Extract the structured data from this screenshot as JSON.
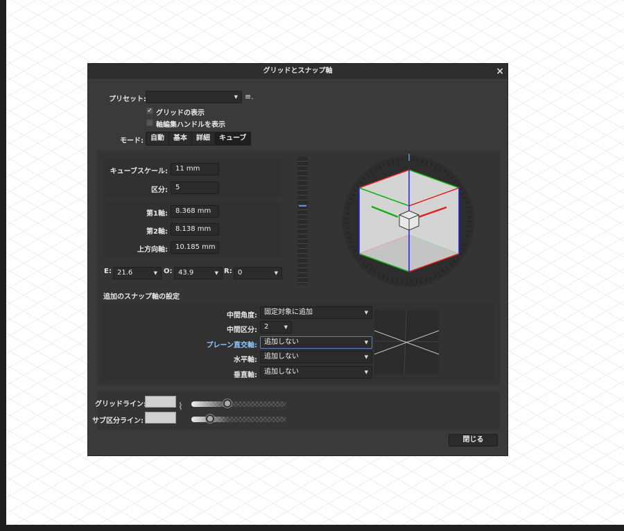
{
  "dialog": {
    "title": "グリッドとスナップ軸",
    "close_icon": "×",
    "close_button": "閉じる"
  },
  "preset": {
    "label": "プリセット:",
    "value": "",
    "menu_icon": "≡."
  },
  "checkboxes": [
    {
      "label": "グリッドの表示",
      "checked": true
    },
    {
      "label": "軸編集ハンドルを表示",
      "checked": false
    }
  ],
  "mode": {
    "label": "モード:",
    "options": [
      "自動",
      "基本",
      "詳細",
      "キューブ"
    ],
    "selected": "キューブ"
  },
  "cube": {
    "scale_label": "キューブスケール:",
    "scale": "11 mm",
    "div_label": "区分:",
    "div": "5",
    "axis1_label": "第1軸:",
    "axis1": "8.368 mm",
    "axis2_label": "第2軸:",
    "axis2": "8.138 mm",
    "up_label": "上方向軸:",
    "up": "10.185 mm",
    "e_label": "E:",
    "e": "21.6",
    "o_label": "O:",
    "o": "43.9",
    "r_label": "R:",
    "r": "0"
  },
  "extra": {
    "title": "追加のスナップ軸の設定",
    "rows": [
      {
        "label": "中間角度:",
        "value": "固定対象に追加"
      },
      {
        "label": "中間区分:",
        "value": "2"
      },
      {
        "label": "プレーン直交軸:",
        "value": "追加しない"
      },
      {
        "label": "水平軸:",
        "value": "追加しない"
      },
      {
        "label": "垂直軸:",
        "value": "追加しない"
      }
    ]
  },
  "lines": {
    "grid_label": "グリッドライン:",
    "sub_label": "サブ区分ライン:",
    "grid_opacity": 0.38,
    "sub_opacity": 0.2
  },
  "colors": {
    "x_axis": "#e02020",
    "y_axis": "#10b010",
    "z_axis": "#1a1aff"
  }
}
